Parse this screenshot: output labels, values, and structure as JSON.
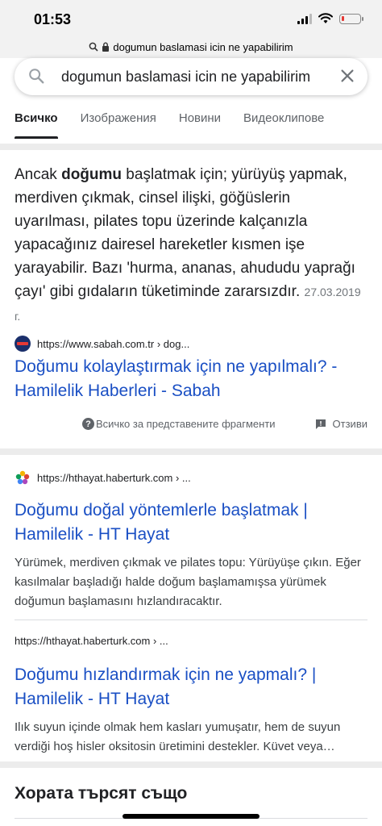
{
  "status_bar": {
    "time": "01:53"
  },
  "url_bar": {
    "text": "dogumun baslamasi icin ne yapabilirim"
  },
  "search": {
    "query": "dogumun baslamasi icin ne yapabilirim"
  },
  "tabs": [
    {
      "label": "Всичко",
      "active": true
    },
    {
      "label": "Изображения"
    },
    {
      "label": "Новини"
    },
    {
      "label": "Видеоклипове"
    }
  ],
  "featured_snippet": {
    "text_before": "Ancak ",
    "bold": "doğumu",
    "text_after": " başlatmak için; yürüyüş yapmak, merdiven çıkmak, cinsel ilişki, göğüslerin uyarılması, pilates topu üzerinde kalçanızla yapacağınız dairesel hareketler kısmen işe yarayabilir. Bazı 'hurma, ananas, ahududu yaprağı çayı' gibi gıdaların tüketiminde zararsızdır.",
    "date": "27.03.2019 г.",
    "source_url": "https://www.sabah.com.tr › dog...",
    "title": "Doğumu kolaylaştırmak için ne yapılmalı? - Hamilelik Haberleri - Sabah",
    "about_label": "Всичко за представените фрагменти",
    "feedback_label": "Отзиви"
  },
  "results": [
    {
      "url": "https://hthayat.haberturk.com › ...",
      "title": "Doğumu doğal yöntemlerle başlatmak | Hamilelik - HT Hayat",
      "description": "Yürümek, merdiven çıkmak ve pilates topu: Yürüyüşe çıkın. Eğer kasılmalar başladığı halde doğum başlamamışsa yürümek doğumun başlamasını hızlandıracaktır."
    },
    {
      "url": "https://hthayat.haberturk.com › ...",
      "title": "Doğumu hızlandırmak için ne yapmalı? | Hamilelik - HT Hayat",
      "description": "Ilık suyun içinde olmak hem kasları yumuşatır, hem de suyun verdiği hoş hisler oksitosin üretimini destekler. Küvet veya…"
    }
  ],
  "people_also_search": {
    "heading": "Хората търсят също"
  },
  "colors": {
    "link": "#1a4fc4",
    "battery_low": "#e53935"
  }
}
